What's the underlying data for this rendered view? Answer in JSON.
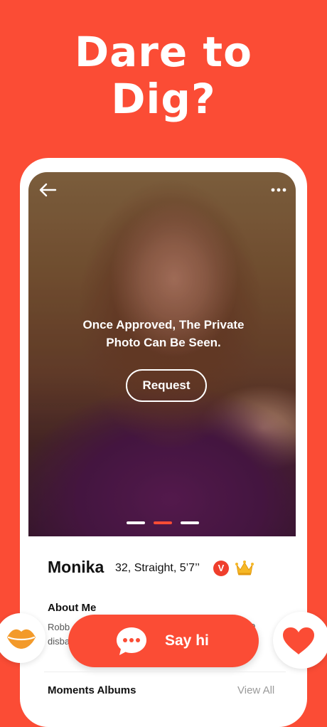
{
  "headline": {
    "line1": "Dare to",
    "line2": "Dig?"
  },
  "photo": {
    "private_message": {
      "line1": "Once Approved, The Private",
      "line2": "Photo Can Be Seen."
    },
    "request_label": "Request",
    "page_indicator": {
      "count": 3,
      "active_index": 1
    },
    "icons": {
      "back": "back-arrow-icon",
      "more": "more-dots-icon"
    }
  },
  "profile": {
    "name": "Monika",
    "info": "32, Straight, 5’7’’",
    "verified_badge": "V",
    "crown_icon": "crown-icon"
  },
  "about": {
    "title": "About Me",
    "text_line1": "Robb",
    "text_line1_tail": "o",
    "text_line2": "disba"
  },
  "actions": {
    "say_hi_label": "Say hi",
    "say_hi_icon": "chat-bubble-icon",
    "kiss_icon": "lips-icon",
    "like_icon": "heart-icon"
  },
  "albums": {
    "title": "Moments Albums",
    "view_all": "View All"
  },
  "colors": {
    "brand": "#fb4c35",
    "kiss": "#f39a2a",
    "white": "#ffffff"
  }
}
